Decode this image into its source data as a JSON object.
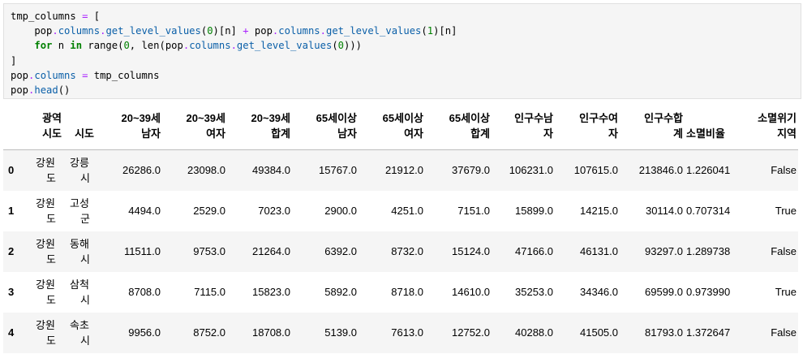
{
  "code_lines": [
    "tmp_columns = [",
    "    pop.columns.get_level_values(0)[n] + pop.columns.get_level_values(1)[n]",
    "    for n in range(0, len(pop.columns.get_level_values(0)))",
    "]",
    "pop.columns = tmp_columns",
    "pop.head()"
  ],
  "table": {
    "headers": [
      [
        "광역",
        "시도"
      ],
      [
        "시도"
      ],
      [
        "20~39세",
        "남자"
      ],
      [
        "20~39세",
        "여자"
      ],
      [
        "20~39세",
        "합계"
      ],
      [
        "65세이상",
        "남자"
      ],
      [
        "65세이상",
        "여자"
      ],
      [
        "65세이상",
        "합계"
      ],
      [
        "인구수남",
        "자"
      ],
      [
        "인구수여",
        "자"
      ],
      [
        "인구수합",
        "계"
      ],
      [
        "소멸비율"
      ],
      [
        "소멸위기",
        "지역"
      ]
    ],
    "rows": [
      {
        "index": "0",
        "sido": [
          "강원",
          "도"
        ],
        "gu": [
          "강릉",
          "시"
        ],
        "values": [
          "26286.0",
          "23098.0",
          "49384.0",
          "15767.0",
          "21912.0",
          "37679.0",
          "106231.0",
          "107615.0",
          "213846.0",
          "1.226041",
          "False"
        ]
      },
      {
        "index": "1",
        "sido": [
          "강원",
          "도"
        ],
        "gu": [
          "고성",
          "군"
        ],
        "values": [
          "4494.0",
          "2529.0",
          "7023.0",
          "2900.0",
          "4251.0",
          "7151.0",
          "15899.0",
          "14215.0",
          "30114.0",
          "0.707314",
          "True"
        ]
      },
      {
        "index": "2",
        "sido": [
          "강원",
          "도"
        ],
        "gu": [
          "동해",
          "시"
        ],
        "values": [
          "11511.0",
          "9753.0",
          "21264.0",
          "6392.0",
          "8732.0",
          "15124.0",
          "47166.0",
          "46131.0",
          "93297.0",
          "1.289738",
          "False"
        ]
      },
      {
        "index": "3",
        "sido": [
          "강원",
          "도"
        ],
        "gu": [
          "삼척",
          "시"
        ],
        "values": [
          "8708.0",
          "7115.0",
          "15823.0",
          "5892.0",
          "8718.0",
          "14610.0",
          "35253.0",
          "34346.0",
          "69599.0",
          "0.973990",
          "True"
        ]
      },
      {
        "index": "4",
        "sido": [
          "강원",
          "도"
        ],
        "gu": [
          "속초",
          "시"
        ],
        "values": [
          "9956.0",
          "8752.0",
          "18708.0",
          "5139.0",
          "7613.0",
          "12752.0",
          "40288.0",
          "41505.0",
          "81793.0",
          "1.372647",
          "False"
        ]
      }
    ]
  }
}
